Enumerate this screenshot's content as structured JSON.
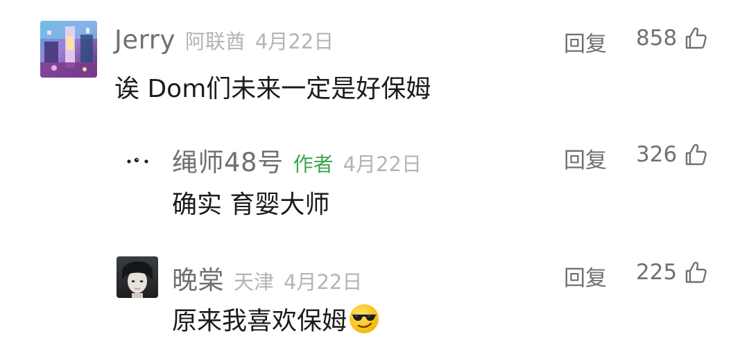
{
  "comments": [
    {
      "username": "Jerry",
      "location": "阿联酋",
      "date": "4月22日",
      "badge": "",
      "text": "诶 Dom们未来一定是好保姆",
      "reply_label": "回复",
      "likes": "858",
      "avatar_icon": "avatar-neon-street-image"
    },
    {
      "username": "绳师48号",
      "location": "",
      "date": "4月22日",
      "badge": "作者",
      "text": "确实 育婴大师",
      "reply_label": "回复",
      "likes": "326",
      "avatar_icon": "avatar-dot-eyes"
    },
    {
      "username": "晚棠",
      "location": "天津",
      "date": "4月22日",
      "badge": "",
      "text": "原来我喜欢保姆",
      "reply_label": "回复",
      "likes": "225",
      "avatar_icon": "avatar-portrait-photo",
      "text_emoji": "sunglasses-face-emoji"
    }
  ],
  "colors": {
    "name": "#707070",
    "meta": "#b4b4b4",
    "author_badge": "#3aa84c",
    "body_text": "#1b1b1b"
  }
}
